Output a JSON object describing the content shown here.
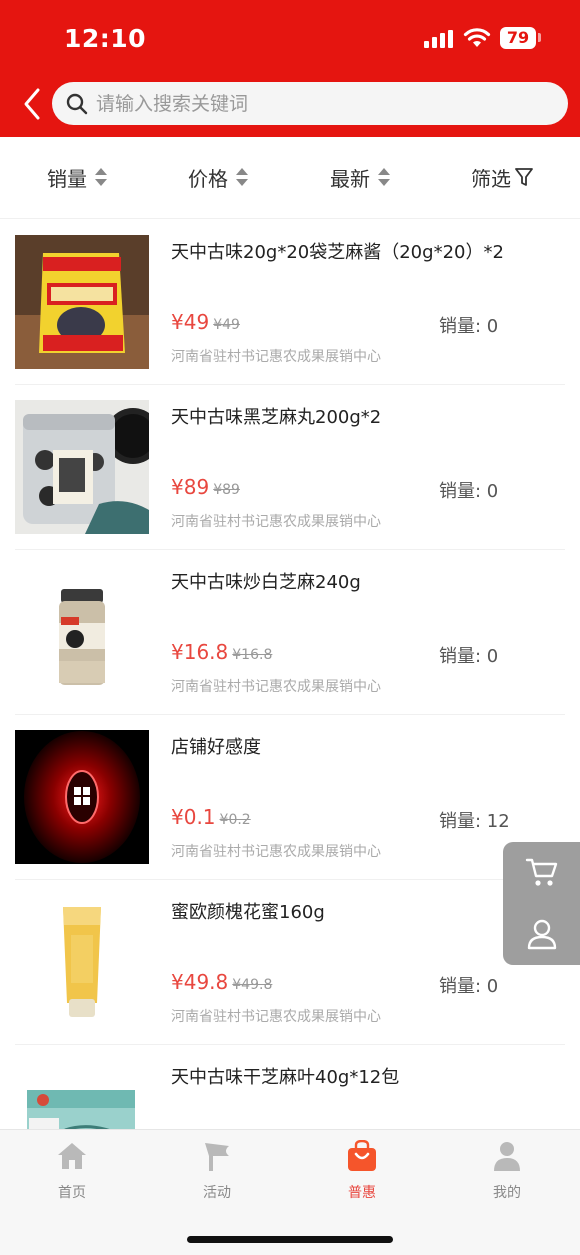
{
  "status": {
    "time": "12:10",
    "battery": "79"
  },
  "search": {
    "placeholder": "请输入搜索关键词"
  },
  "sort": {
    "sales": "销量",
    "price": "价格",
    "newest": "最新",
    "filter": "筛选"
  },
  "colors": {
    "brand": "#e51510",
    "price": "#e8473f"
  },
  "products": [
    {
      "title": "天中古味20g*20袋芝麻酱（20g*20）*2",
      "price": "¥49",
      "orig": "¥49",
      "sales": "销量: 0",
      "shop": "河南省驻村书记惠农成果展销中心"
    },
    {
      "title": "天中古味黑芝麻丸200g*2",
      "price": "¥89",
      "orig": "¥89",
      "sales": "销量: 0",
      "shop": "河南省驻村书记惠农成果展销中心"
    },
    {
      "title": "天中古味炒白芝麻240g",
      "price": "¥16.8",
      "orig": "¥16.8",
      "sales": "销量: 0",
      "shop": "河南省驻村书记惠农成果展销中心"
    },
    {
      "title": "店铺好感度",
      "price": "¥0.1",
      "orig": "¥0.2",
      "sales": "销量: 12",
      "shop": "河南省驻村书记惠农成果展销中心"
    },
    {
      "title": "蜜欧颜槐花蜜160g",
      "price": "¥49.8",
      "orig": "¥49.8",
      "sales": "销量: 0",
      "shop": "河南省驻村书记惠农成果展销中心"
    },
    {
      "title": "天中古味干芝麻叶40g*12包"
    }
  ],
  "tabs": {
    "home": "首页",
    "activity": "活动",
    "benefit": "普惠",
    "mine": "我的"
  }
}
